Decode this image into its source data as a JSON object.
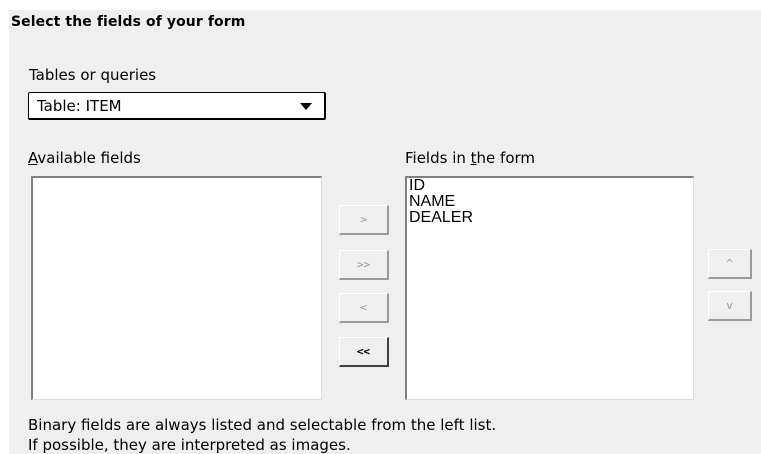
{
  "title": "Select the fields of your form",
  "tables_label": "Tables or queries",
  "table_select": {
    "value": "Table: ITEM"
  },
  "available": {
    "label_accel": "A",
    "label_rest": "vailable fields",
    "items": []
  },
  "form_fields": {
    "label_pre": "Fields in ",
    "label_accel": "t",
    "label_rest": "he form",
    "items": [
      "ID",
      "NAME",
      "DEALER"
    ]
  },
  "buttons": {
    "add_one": ">",
    "add_all": ">>",
    "remove_one": "<",
    "remove_all": "<<",
    "move_up": "^",
    "move_down": "v"
  },
  "note": {
    "line1": "Binary fields are always listed and selectable from the left list.",
    "line2": "If possible, they are interpreted as images."
  }
}
